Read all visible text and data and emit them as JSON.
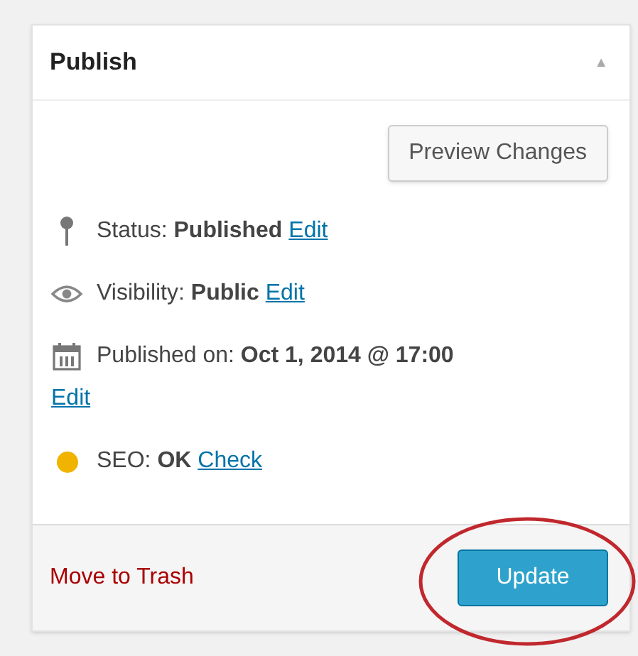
{
  "panel": {
    "title": "Publish",
    "collapse_icon": "▲"
  },
  "preview_button": "Preview Changes",
  "rows": [
    {
      "kind": "pin",
      "text": "Status: **Published**",
      "link": "Edit"
    },
    {
      "kind": "eye",
      "text": "Visibility: **Public**",
      "link": "Edit"
    },
    {
      "kind": "calendar",
      "text": "Published on: **Oct 1, 2014 @ 17:00**",
      "link": "Edit"
    },
    {
      "kind": "dot",
      "color": "#f0b400",
      "text": "SEO: **OK**",
      "link": "Check"
    }
  ],
  "footer": {
    "trash_link": "Move to Trash",
    "update_button": "Update"
  }
}
